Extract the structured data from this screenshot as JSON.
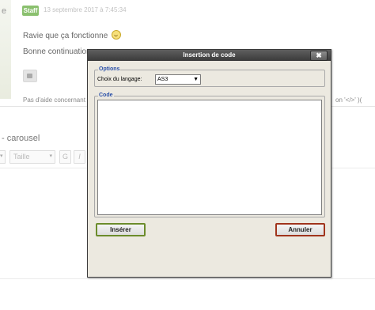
{
  "background": {
    "left_char": "e",
    "staff_badge": "Staff",
    "post_date": "13 septembre 2017 à 7:45:34",
    "post_line1": "Ravie que ça fonctionne",
    "post_line2": "Bonne continuation :",
    "help_text": "Pas d'aide concernant",
    "help_text_right": "on '</>' )(",
    "section_title": "- carousel",
    "size_placeholder": "Taille",
    "bold_btn": "G",
    "italic_btn": "I"
  },
  "dialog": {
    "title": "Insertion de code",
    "close_label": "✖",
    "options_legend": "Options",
    "language_label": "Choix du langage:",
    "language_value": "AS3",
    "code_legend": "Code",
    "code_value": "",
    "insert_label": "Insérer",
    "cancel_label": "Annuler"
  },
  "colors": {
    "titlebar": "#4a4a4a",
    "dialog_bg": "#ece9e0",
    "legend_blue": "#2a50a8",
    "insert_border": "#6c8c2c",
    "cancel_border": "#a0341c",
    "staff_badge": "#8ac06e"
  }
}
